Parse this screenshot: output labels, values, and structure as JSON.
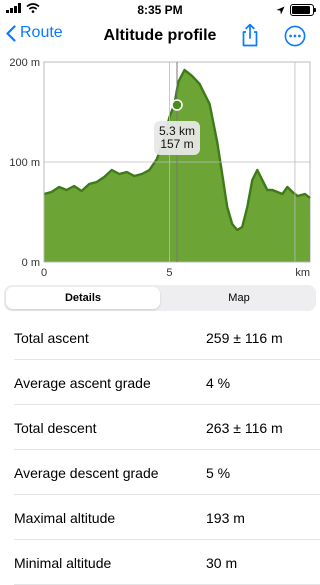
{
  "status": {
    "time": "8:35 PM"
  },
  "nav": {
    "back_label": "Route",
    "title": "Altitude profile"
  },
  "chart_data": {
    "type": "area",
    "xlabel": "km",
    "ylabel": "",
    "xlim": [
      0,
      10.6
    ],
    "ylim": [
      0,
      200
    ],
    "x_ticks": [
      "0",
      "5",
      "km"
    ],
    "y_ticks": [
      "0 m",
      "100 m",
      "200 m"
    ],
    "series": [
      {
        "x": [
          0,
          0.3,
          0.6,
          0.9,
          1.2,
          1.5,
          1.8,
          2.1,
          2.4,
          2.7,
          3.0,
          3.3,
          3.6,
          3.9,
          4.2,
          4.5,
          4.8,
          5.0,
          5.2,
          5.35,
          5.6,
          5.9,
          6.2,
          6.6,
          6.9,
          7.1,
          7.3,
          7.5,
          7.7,
          7.9,
          8.1,
          8.3,
          8.5,
          8.7,
          8.9,
          9.1,
          9.3,
          9.5,
          9.7,
          9.9,
          10.1,
          10.4,
          10.6
        ],
        "y": [
          68,
          70,
          75,
          72,
          76,
          71,
          78,
          80,
          85,
          92,
          88,
          90,
          86,
          88,
          92,
          103,
          125,
          145,
          158,
          180,
          192,
          186,
          178,
          158,
          120,
          88,
          55,
          38,
          32,
          35,
          55,
          82,
          92,
          82,
          72,
          72,
          70,
          68,
          75,
          70,
          66,
          68,
          64
        ]
      }
    ],
    "marker": {
      "x": 5.3,
      "y": 157
    },
    "annotation": [
      "5.3 km",
      "157 m"
    ],
    "colors": {
      "fill": "#6ca535",
      "line": "#3e7a18",
      "marker": "#4a8a1f"
    }
  },
  "tabs": [
    {
      "label": "Details",
      "active": true
    },
    {
      "label": "Map",
      "active": false
    }
  ],
  "stats": [
    {
      "label": "Total ascent",
      "value": "259 ± 116 m"
    },
    {
      "label": "Average ascent grade",
      "value": "4 %"
    },
    {
      "label": "Total descent",
      "value": "263 ± 116 m"
    },
    {
      "label": "Average descent grade",
      "value": "5 %"
    },
    {
      "label": "Maximal altitude",
      "value": "193 m"
    },
    {
      "label": "Minimal altitude",
      "value": "30 m"
    }
  ],
  "icons": {
    "back": "chevron-left-icon",
    "share": "share-icon",
    "more": "ellipsis-circle-icon",
    "wifi": "wifi-icon",
    "location": "location-arrow-icon",
    "battery": "battery-icon"
  },
  "battery_level": 0.95
}
